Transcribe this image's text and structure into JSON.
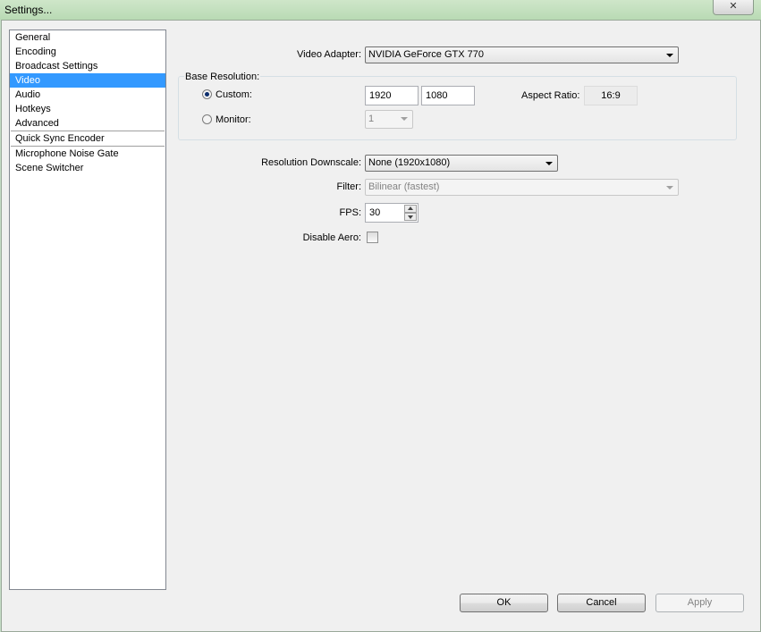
{
  "window": {
    "title": "Settings...",
    "close_icon": "✕"
  },
  "sidebar": {
    "items": [
      "General",
      "Encoding",
      "Broadcast Settings",
      "Video",
      "Audio",
      "Hotkeys",
      "Advanced"
    ],
    "plugin_items": [
      "Quick Sync Encoder",
      "Microphone Noise Gate",
      "Scene Switcher"
    ],
    "selected": "Video"
  },
  "video": {
    "adapter_label": "Video Adapter:",
    "adapter_value": "NVIDIA GeForce GTX 770",
    "base_resolution_label": "Base Resolution:",
    "custom_label": "Custom:",
    "custom_selected": true,
    "width": "1920",
    "height": "1080",
    "aspect_ratio_label": "Aspect Ratio:",
    "aspect_ratio_value": "16:9",
    "monitor_label": "Monitor:",
    "monitor_value": "1",
    "downscale_label": "Resolution Downscale:",
    "downscale_value": "None  (1920x1080)",
    "filter_label": "Filter:",
    "filter_value": "Bilinear (fastest)",
    "fps_label": "FPS:",
    "fps_value": "30",
    "disable_aero_label": "Disable Aero:",
    "disable_aero_checked": false
  },
  "buttons": {
    "ok": "OK",
    "cancel": "Cancel",
    "apply": "Apply"
  },
  "colors": {
    "selection": "#3399ff",
    "titlebar": "#c5dcc6",
    "dialog_bg": "#f0f0f0"
  }
}
